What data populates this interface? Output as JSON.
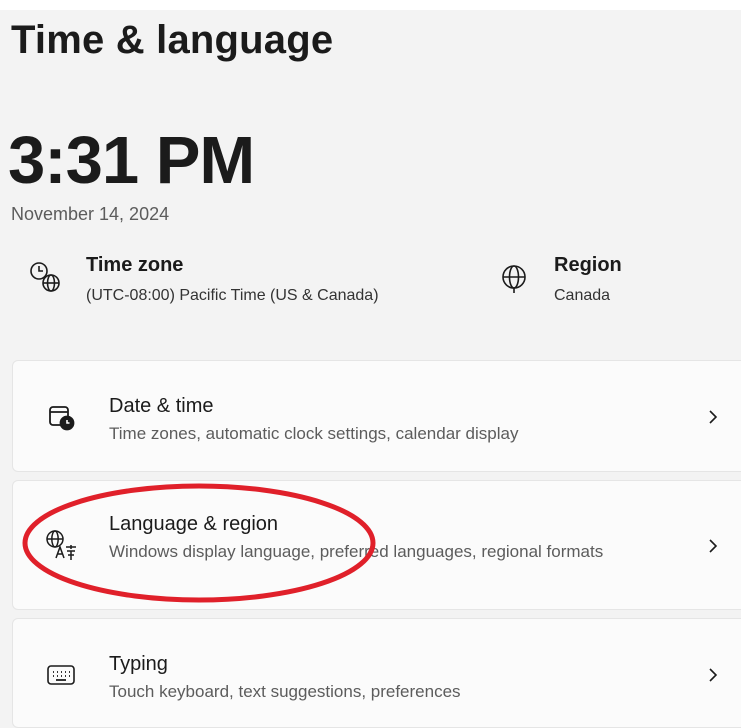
{
  "page": {
    "title": "Time & language"
  },
  "clock": {
    "time": "3:31 PM",
    "date": "November 14, 2024"
  },
  "timezone": {
    "icon": "clock-globe-icon",
    "title": "Time zone",
    "value": "(UTC-08:00) Pacific Time (US & Canada)"
  },
  "region": {
    "icon": "globe-icon",
    "title": "Region",
    "value": "Canada"
  },
  "cards": {
    "date_time": {
      "icon": "calendar-clock-icon",
      "title": "Date & time",
      "description": "Time zones, automatic clock settings, calendar display"
    },
    "language_region": {
      "icon": "language-icon",
      "title": "Language & region",
      "description": "Windows display language, preferred languages, regional formats"
    },
    "typing": {
      "icon": "keyboard-icon",
      "title": "Typing",
      "description": "Touch keyboard, text suggestions, preferences"
    }
  },
  "annotation": {
    "highlight_color": "#e0202a"
  },
  "colors": {
    "background": "#f3f3f3",
    "card": "#fbfbfb",
    "text_primary": "#1b1b1b",
    "text_secondary": "#5c5c5c"
  }
}
